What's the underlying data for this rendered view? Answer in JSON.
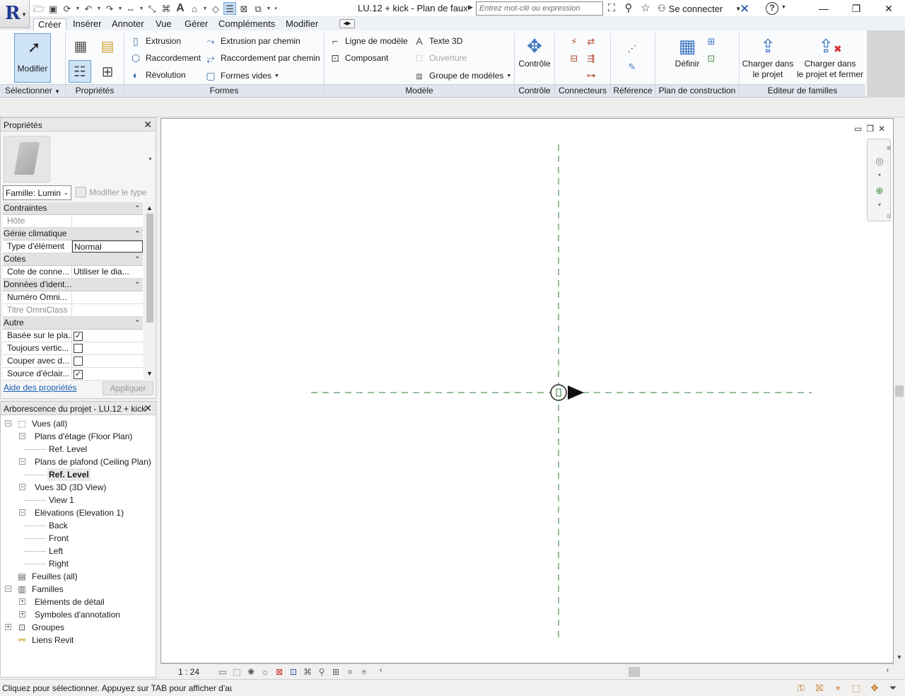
{
  "app": {
    "logo": "R",
    "title": "LU.12 + kick - Plan de faux-...",
    "search_placeholder": "Entrez mot-clé ou expression",
    "sign_in": "Se connecter",
    "quick_access_icons": [
      "open-icon",
      "save-icon",
      "sync-icon",
      "undo-icon",
      "redo-icon",
      "measure-icon",
      "dimension-icon",
      "tag-icon",
      "text-icon",
      "3d-view-icon",
      "section-icon",
      "thin-lines-icon",
      "close-hidden-icon",
      "switch-windows-icon"
    ]
  },
  "ribbon": {
    "tabs": [
      "Créer",
      "Insérer",
      "Annoter",
      "Vue",
      "Gérer",
      "Compléments",
      "Modifier"
    ],
    "active_tab": "Créer",
    "panels": {
      "select": {
        "title": "Sélectionner",
        "modify": "Modifier"
      },
      "properties": {
        "title": "Propriétés"
      },
      "forms": {
        "title": "Formes",
        "commands": [
          "Extrusion",
          "Raccordement",
          "Révolution",
          "Extrusion par chemin",
          "Raccordement par chemin",
          "Formes vides"
        ]
      },
      "model": {
        "title": "Modèle",
        "commands": [
          "Ligne de modèle",
          "Composant",
          "Texte 3D",
          "Ouverture",
          "Groupe de modèles"
        ]
      },
      "control": {
        "title": "Contrôle",
        "command": "Contrôle"
      },
      "connectors": {
        "title": "Connecteurs"
      },
      "reference": {
        "title": "Référence"
      },
      "work_plane": {
        "title": "Plan de construction",
        "command": "Définir"
      },
      "family_editor": {
        "title": "Editeur de familles",
        "load_line1": "Charger dans",
        "load_line2": "le projet",
        "load_close_line1": "Charger dans",
        "load_close_line2": "le projet et fermer"
      }
    }
  },
  "properties": {
    "title": "Propriétés",
    "family_select": "Famille: Lumin",
    "edit_type": "Modifier le type",
    "groups": [
      {
        "name": "Contraintes",
        "rows": [
          {
            "name": "Hôte",
            "value": "",
            "disabled": true
          }
        ]
      },
      {
        "name": "Génie climatique",
        "rows": [
          {
            "name": "Type d'élément",
            "value": "Normal",
            "editing": true
          }
        ]
      },
      {
        "name": "Cotes",
        "rows": [
          {
            "name": "Cote de conne...",
            "value": "Utiliser le dia..."
          }
        ]
      },
      {
        "name": "Données d'ident...",
        "rows": [
          {
            "name": "Numéro Omni...",
            "value": ""
          },
          {
            "name": "Titre OmniClass",
            "value": "",
            "disabled": true
          }
        ]
      },
      {
        "name": "Autre",
        "rows": [
          {
            "name": "Basée sur le pla...",
            "checked": true
          },
          {
            "name": "Toujours vertic...",
            "checked": false
          },
          {
            "name": "Couper avec d...",
            "checked": false
          },
          {
            "name": "Source d'éclair...",
            "checked": true
          }
        ]
      }
    ],
    "help_link": "Aide des propriétés",
    "apply": "Appliquer"
  },
  "browser": {
    "title": "Arborescence du projet - LU.12 + kick",
    "nodes": [
      {
        "label": "Vues (all)",
        "level": 0,
        "toggle": "−",
        "icon": "views-icon"
      },
      {
        "label": "Plans d'étage (Floor Plan)",
        "level": 1,
        "toggle": "−"
      },
      {
        "label": "Ref. Level",
        "level": 2
      },
      {
        "label": "Plans de plafond (Ceiling Plan)",
        "level": 1,
        "toggle": "−"
      },
      {
        "label": "Ref. Level",
        "level": 2,
        "bold": true
      },
      {
        "label": "Vues 3D (3D View)",
        "level": 1,
        "toggle": "−"
      },
      {
        "label": "View 1",
        "level": 2
      },
      {
        "label": "Elévations (Elevation 1)",
        "level": 1,
        "toggle": "−"
      },
      {
        "label": "Back",
        "level": 2
      },
      {
        "label": "Front",
        "level": 2
      },
      {
        "label": "Left",
        "level": 2
      },
      {
        "label": "Right",
        "level": 2
      },
      {
        "label": "Feuilles (all)",
        "level": 0,
        "icon": "sheets-icon"
      },
      {
        "label": "Familles",
        "level": 0,
        "toggle": "−",
        "icon": "families-icon"
      },
      {
        "label": "Eléments de détail",
        "level": 1,
        "toggle": "+"
      },
      {
        "label": "Symboles d'annotation",
        "level": 1,
        "toggle": "+"
      },
      {
        "label": "Groupes",
        "level": 0,
        "toggle": "+",
        "icon": "groups-icon"
      },
      {
        "label": "Liens Revit",
        "level": 0,
        "icon": "links-icon"
      }
    ]
  },
  "view": {
    "scale": "1 : 24"
  },
  "status": {
    "text": "Cliquez pour sélectionner. Appuyez sur TAB pour afficher d'au"
  },
  "colors": {
    "ref_plane": "#2e7d32",
    "accent": "#1f3a8f",
    "link": "#1a5fb4"
  }
}
